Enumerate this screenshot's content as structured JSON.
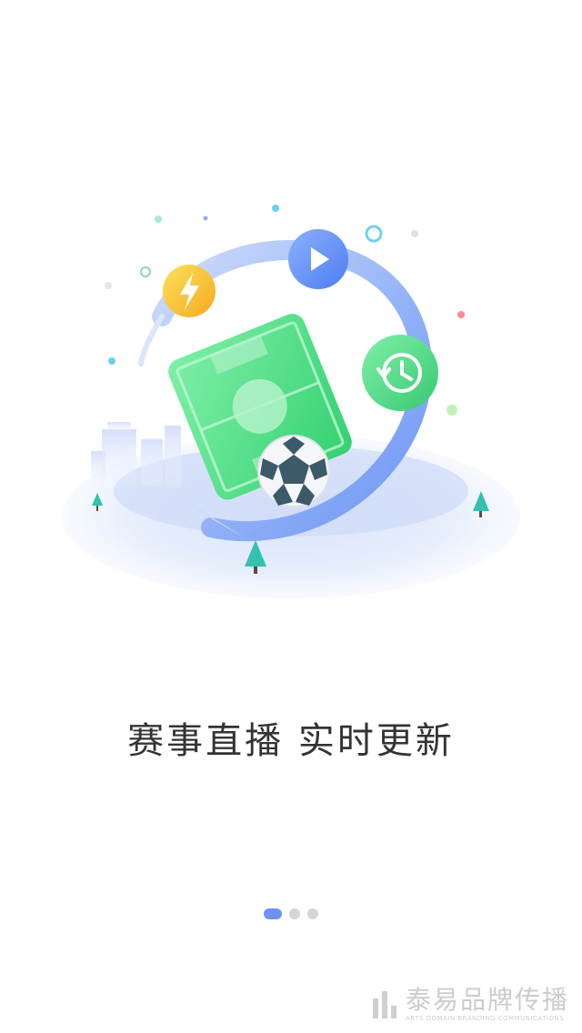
{
  "headline": "赛事直播  实时更新",
  "pager": {
    "count": 3,
    "active_index": 0
  },
  "illustration": {
    "icons": [
      "lightning-icon",
      "play-icon",
      "history-icon",
      "soccer-ball-icon",
      "soccer-field-card-icon",
      "tree-icon",
      "building-icon"
    ]
  },
  "watermark": {
    "main": "泰易品牌传播",
    "sub": "ARTS DOMAIN BRANDING COMMUNICATIONS"
  },
  "colors": {
    "primary": "#6a93f6",
    "green": "#45d47f",
    "yellow": "#f6c21f",
    "text": "#333333"
  }
}
